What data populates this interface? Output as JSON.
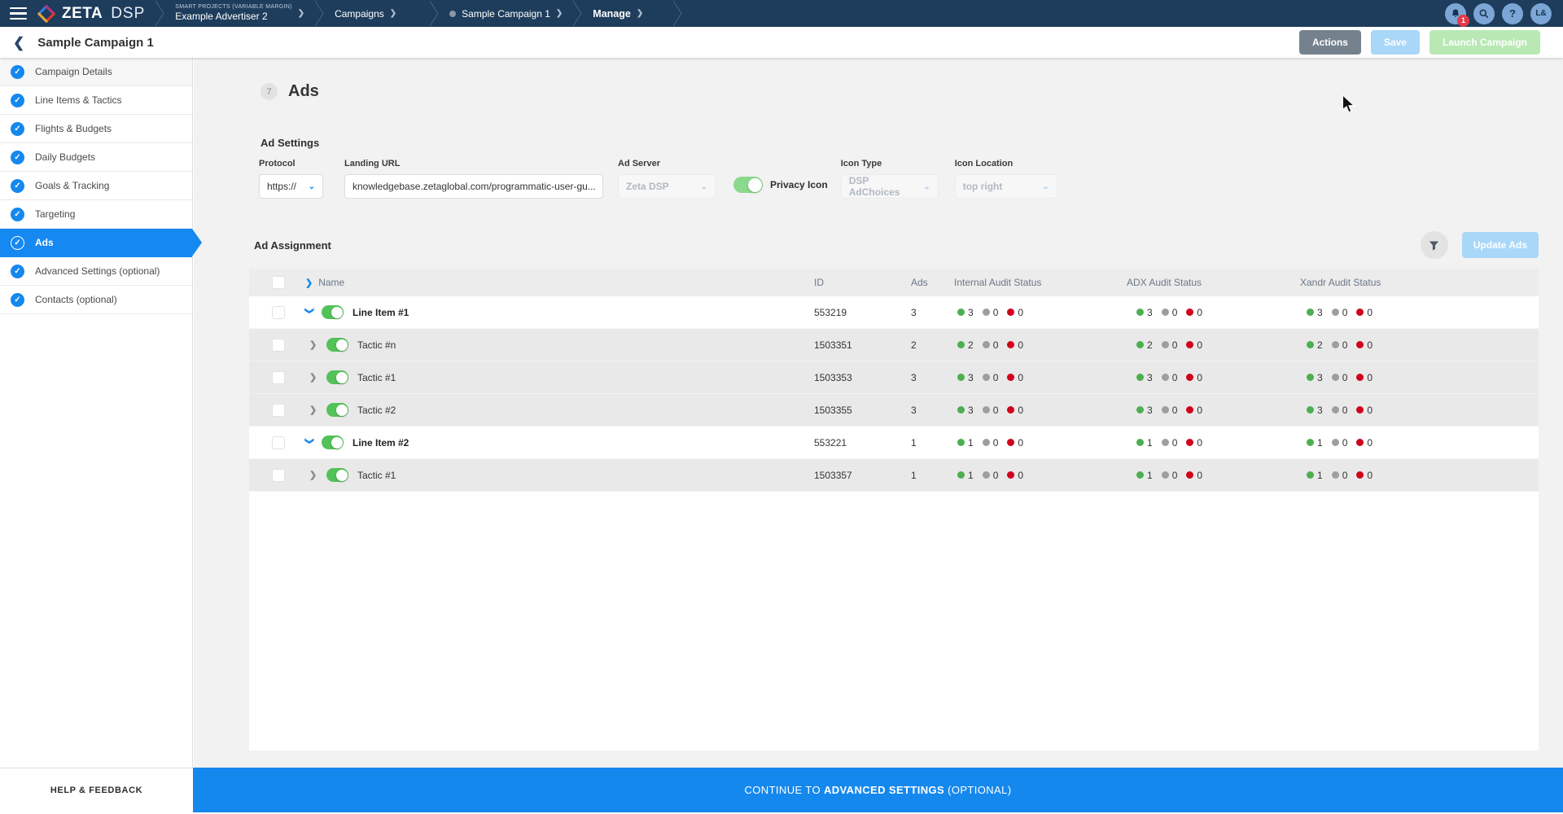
{
  "topnav": {
    "logo": {
      "zeta": "ZETA",
      "dsp": "DSP"
    },
    "breadcrumbs": {
      "advertiser_kicker": "SMART PROJECTS (VARIABLE MARGIN)",
      "advertiser_name": "Example Advertiser 2",
      "campaigns": "Campaigns",
      "campaign": "Sample Campaign 1",
      "manage": "Manage"
    },
    "notification_count": "1",
    "help_glyph": "?",
    "avatar_initials": "L&"
  },
  "header": {
    "back_glyph": "❮",
    "title": "Sample Campaign 1",
    "actions_label": "Actions",
    "save_label": "Save",
    "launch_label": "Launch Campaign"
  },
  "sidebar": {
    "items": [
      {
        "label": "Campaign Details",
        "slug": "campaign-details",
        "active": false
      },
      {
        "label": "Line Items & Tactics",
        "slug": "line-items-tactics",
        "active": false
      },
      {
        "label": "Flights & Budgets",
        "slug": "flights-budgets",
        "active": false
      },
      {
        "label": "Daily Budgets",
        "slug": "daily-budgets",
        "active": false
      },
      {
        "label": "Goals & Tracking",
        "slug": "goals-tracking",
        "active": false
      },
      {
        "label": "Targeting",
        "slug": "targeting",
        "active": false
      },
      {
        "label": "Ads",
        "slug": "ads",
        "active": true
      },
      {
        "label": "Advanced Settings (optional)",
        "slug": "advanced-settings",
        "active": false
      },
      {
        "label": "Contacts (optional)",
        "slug": "contacts",
        "active": false
      }
    ],
    "check_glyph": "✓",
    "help_label": "HELP & FEEDBACK"
  },
  "main": {
    "step_number": "7",
    "title": "Ads",
    "ad_settings": {
      "section_title": "Ad Settings",
      "protocol": {
        "label": "Protocol",
        "value": "https://"
      },
      "landing_url": {
        "label": "Landing URL",
        "value": "knowledgebase.zetaglobal.com/programmatic-user-gu..."
      },
      "ad_server": {
        "label": "Ad Server",
        "value": "Zeta DSP",
        "disabled": true
      },
      "privacy_icon": {
        "label": "Privacy Icon",
        "enabled": true
      },
      "icon_type": {
        "label": "Icon Type",
        "value": "DSP AdChoices",
        "disabled": true
      },
      "icon_location": {
        "label": "Icon Location",
        "value": "top right",
        "disabled": true
      }
    },
    "ad_assignment": {
      "section_title": "Ad Assignment",
      "update_button": "Update Ads",
      "table": {
        "columns": [
          "Name",
          "ID",
          "Ads",
          "Internal Audit Status",
          "ADX Audit Status",
          "Xandr Audit Status"
        ],
        "rows": [
          {
            "type": "line-item",
            "expanded": true,
            "enabled": true,
            "name": "Line Item #1",
            "id": "553219",
            "ads": "3",
            "internal": [
              "3",
              "0",
              "0"
            ],
            "adx": [
              "3",
              "0",
              "0"
            ],
            "xandr": [
              "3",
              "0",
              "0"
            ]
          },
          {
            "type": "tactic",
            "expanded": false,
            "enabled": true,
            "name": "Tactic #n",
            "id": "1503351",
            "ads": "2",
            "internal": [
              "2",
              "0",
              "0"
            ],
            "adx": [
              "2",
              "0",
              "0"
            ],
            "xandr": [
              "2",
              "0",
              "0"
            ]
          },
          {
            "type": "tactic",
            "expanded": false,
            "enabled": true,
            "name": "Tactic #1",
            "id": "1503353",
            "ads": "3",
            "internal": [
              "3",
              "0",
              "0"
            ],
            "adx": [
              "3",
              "0",
              "0"
            ],
            "xandr": [
              "3",
              "0",
              "0"
            ]
          },
          {
            "type": "tactic",
            "expanded": false,
            "enabled": true,
            "name": "Tactic #2",
            "id": "1503355",
            "ads": "3",
            "internal": [
              "3",
              "0",
              "0"
            ],
            "adx": [
              "3",
              "0",
              "0"
            ],
            "xandr": [
              "3",
              "0",
              "0"
            ]
          },
          {
            "type": "line-item",
            "expanded": true,
            "enabled": true,
            "name": "Line Item #2",
            "id": "553221",
            "ads": "1",
            "internal": [
              "1",
              "0",
              "0"
            ],
            "adx": [
              "1",
              "0",
              "0"
            ],
            "xandr": [
              "1",
              "0",
              "0"
            ]
          },
          {
            "type": "tactic",
            "expanded": false,
            "enabled": true,
            "name": "Tactic #1",
            "id": "1503357",
            "ads": "1",
            "internal": [
              "1",
              "0",
              "0"
            ],
            "adx": [
              "1",
              "0",
              "0"
            ],
            "xandr": [
              "1",
              "0",
              "0"
            ]
          }
        ]
      }
    }
  },
  "footer": {
    "continue_prefix": "CONTINUE TO",
    "continue_emphasis": "ADVANCED SETTINGS",
    "continue_suffix": "(OPTIONAL)"
  },
  "colors": {
    "topnav_navy": "#1E3D5C",
    "accent_blue": "#1588EE",
    "toggle_green": "#53C258",
    "status_approved_green": "#4CAF50",
    "status_pending_gray": "#9E9E9E",
    "status_rejected_red": "#D0021B",
    "disabled_save_blue": "#A9D7F7",
    "disabled_launch_green": "#B9E8B4",
    "actions_gray": "#75828E"
  }
}
